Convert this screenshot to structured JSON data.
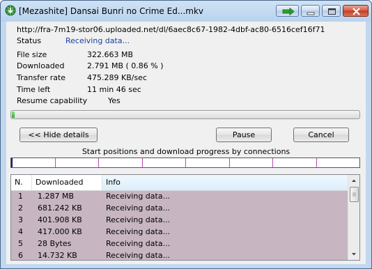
{
  "window": {
    "title": "[Mezashite] Dansai Bunri no Crime Ed...mkv",
    "app_icon": "idm-globe-icon",
    "caption_buttons": [
      "go-icon",
      "minimize-icon",
      "maximize-icon",
      "close-icon"
    ]
  },
  "download": {
    "url": "http://fra-7m19-stor06.uploaded.net/dl/6aec8c67-1982-4dbf-ac80-6516cef16f71",
    "status_label": "Status",
    "status_value": "Receiving data...",
    "fields": [
      {
        "label": "File size",
        "value": "322.663  MB"
      },
      {
        "label": "Downloaded",
        "value": "2.791  MB  ( 0.86 % )"
      },
      {
        "label": "Transfer rate",
        "value": "475.289  KB/sec"
      },
      {
        "label": "Time left",
        "value": "11 min 46 sec"
      },
      {
        "label": "Resume capability",
        "value": "Yes"
      }
    ],
    "progress_fraction": 0.0086
  },
  "buttons": {
    "hide_details": "<< Hide details",
    "pause": "Pause",
    "cancel": "Cancel"
  },
  "connections": {
    "caption": "Start positions and download progress by connections",
    "count": 8
  },
  "table": {
    "headers": [
      "N.",
      "Downloaded",
      "Info"
    ],
    "rows": [
      {
        "n": "1",
        "downloaded": "1.287  MB",
        "info": "Receiving data..."
      },
      {
        "n": "2",
        "downloaded": "681.242  KB",
        "info": "Receiving data..."
      },
      {
        "n": "3",
        "downloaded": "401.908  KB",
        "info": "Receiving data..."
      },
      {
        "n": "4",
        "downloaded": "417.000  KB",
        "info": "Receiving data..."
      },
      {
        "n": "5",
        "downloaded": "28  Bytes",
        "info": "Receiving data..."
      },
      {
        "n": "6",
        "downloaded": "14.732  KB",
        "info": "Receiving data..."
      }
    ]
  },
  "colors": {
    "progress_green": "#1db31d",
    "status_blue": "#1a3fa0",
    "row_background": "#c7b6c1",
    "connection_marker": "#b64fb6"
  }
}
